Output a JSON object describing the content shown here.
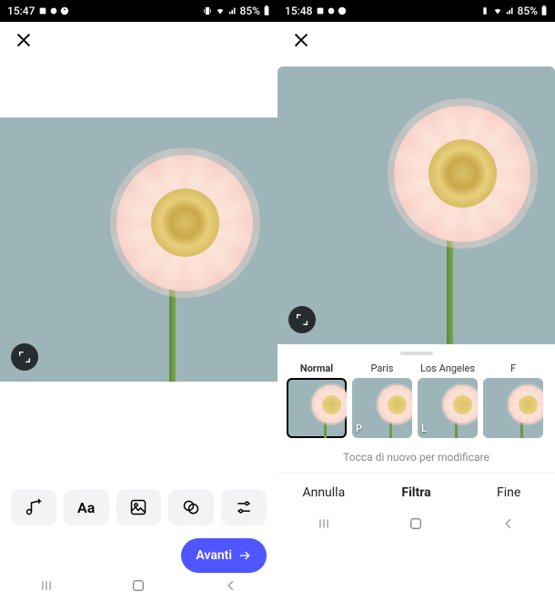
{
  "left": {
    "status": {
      "time": "15:47",
      "battery": "85%"
    },
    "toolbar": {
      "music": "music-plus",
      "text": "Aa",
      "sticker": "image",
      "effects": "overlap",
      "adjust": "sliders"
    },
    "next_label": "Avanti"
  },
  "right": {
    "status": {
      "time": "15:48",
      "battery": "85%"
    },
    "filters": [
      {
        "label": "Normal",
        "badge": "",
        "selected": true
      },
      {
        "label": "Paris",
        "badge": "P",
        "selected": false
      },
      {
        "label": "Los Angeles",
        "badge": "L",
        "selected": false
      },
      {
        "label": "F",
        "badge": "",
        "selected": false
      }
    ],
    "hint": "Tocca di nuovo per modificare",
    "tabs": {
      "cancel": "Annulla",
      "filter": "Filtra",
      "done": "Fine"
    }
  },
  "nav": {
    "recents": "|||",
    "home": "◯",
    "back": "〈"
  }
}
